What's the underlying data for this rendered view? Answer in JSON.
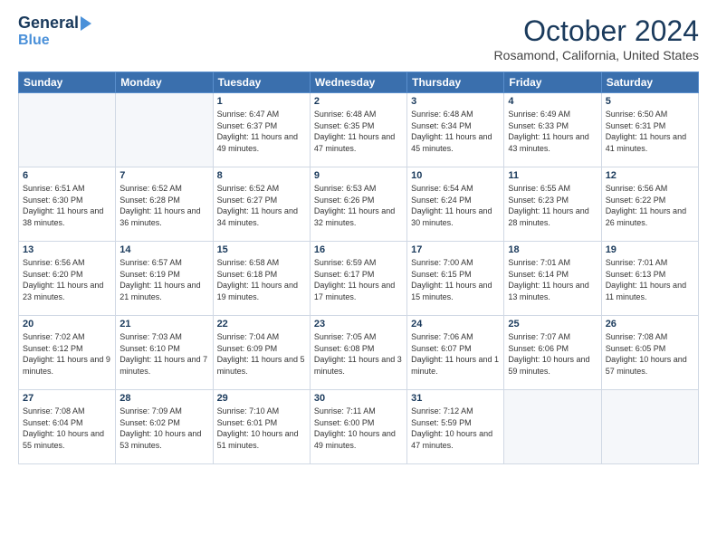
{
  "logo": {
    "line1": "General",
    "line2": "Blue"
  },
  "header": {
    "month": "October 2024",
    "location": "Rosamond, California, United States"
  },
  "weekdays": [
    "Sunday",
    "Monday",
    "Tuesday",
    "Wednesday",
    "Thursday",
    "Friday",
    "Saturday"
  ],
  "weeks": [
    [
      {
        "day": "",
        "empty": true
      },
      {
        "day": "",
        "empty": true
      },
      {
        "day": "1",
        "rise": "6:47 AM",
        "set": "6:37 PM",
        "daylight": "11 hours and 49 minutes."
      },
      {
        "day": "2",
        "rise": "6:48 AM",
        "set": "6:35 PM",
        "daylight": "11 hours and 47 minutes."
      },
      {
        "day": "3",
        "rise": "6:48 AM",
        "set": "6:34 PM",
        "daylight": "11 hours and 45 minutes."
      },
      {
        "day": "4",
        "rise": "6:49 AM",
        "set": "6:33 PM",
        "daylight": "11 hours and 43 minutes."
      },
      {
        "day": "5",
        "rise": "6:50 AM",
        "set": "6:31 PM",
        "daylight": "11 hours and 41 minutes."
      }
    ],
    [
      {
        "day": "6",
        "rise": "6:51 AM",
        "set": "6:30 PM",
        "daylight": "11 hours and 38 minutes."
      },
      {
        "day": "7",
        "rise": "6:52 AM",
        "set": "6:28 PM",
        "daylight": "11 hours and 36 minutes."
      },
      {
        "day": "8",
        "rise": "6:52 AM",
        "set": "6:27 PM",
        "daylight": "11 hours and 34 minutes."
      },
      {
        "day": "9",
        "rise": "6:53 AM",
        "set": "6:26 PM",
        "daylight": "11 hours and 32 minutes."
      },
      {
        "day": "10",
        "rise": "6:54 AM",
        "set": "6:24 PM",
        "daylight": "11 hours and 30 minutes."
      },
      {
        "day": "11",
        "rise": "6:55 AM",
        "set": "6:23 PM",
        "daylight": "11 hours and 28 minutes."
      },
      {
        "day": "12",
        "rise": "6:56 AM",
        "set": "6:22 PM",
        "daylight": "11 hours and 26 minutes."
      }
    ],
    [
      {
        "day": "13",
        "rise": "6:56 AM",
        "set": "6:20 PM",
        "daylight": "11 hours and 23 minutes."
      },
      {
        "day": "14",
        "rise": "6:57 AM",
        "set": "6:19 PM",
        "daylight": "11 hours and 21 minutes."
      },
      {
        "day": "15",
        "rise": "6:58 AM",
        "set": "6:18 PM",
        "daylight": "11 hours and 19 minutes."
      },
      {
        "day": "16",
        "rise": "6:59 AM",
        "set": "6:17 PM",
        "daylight": "11 hours and 17 minutes."
      },
      {
        "day": "17",
        "rise": "7:00 AM",
        "set": "6:15 PM",
        "daylight": "11 hours and 15 minutes."
      },
      {
        "day": "18",
        "rise": "7:01 AM",
        "set": "6:14 PM",
        "daylight": "11 hours and 13 minutes."
      },
      {
        "day": "19",
        "rise": "7:01 AM",
        "set": "6:13 PM",
        "daylight": "11 hours and 11 minutes."
      }
    ],
    [
      {
        "day": "20",
        "rise": "7:02 AM",
        "set": "6:12 PM",
        "daylight": "11 hours and 9 minutes."
      },
      {
        "day": "21",
        "rise": "7:03 AM",
        "set": "6:10 PM",
        "daylight": "11 hours and 7 minutes."
      },
      {
        "day": "22",
        "rise": "7:04 AM",
        "set": "6:09 PM",
        "daylight": "11 hours and 5 minutes."
      },
      {
        "day": "23",
        "rise": "7:05 AM",
        "set": "6:08 PM",
        "daylight": "11 hours and 3 minutes."
      },
      {
        "day": "24",
        "rise": "7:06 AM",
        "set": "6:07 PM",
        "daylight": "11 hours and 1 minute."
      },
      {
        "day": "25",
        "rise": "7:07 AM",
        "set": "6:06 PM",
        "daylight": "10 hours and 59 minutes."
      },
      {
        "day": "26",
        "rise": "7:08 AM",
        "set": "6:05 PM",
        "daylight": "10 hours and 57 minutes."
      }
    ],
    [
      {
        "day": "27",
        "rise": "7:08 AM",
        "set": "6:04 PM",
        "daylight": "10 hours and 55 minutes."
      },
      {
        "day": "28",
        "rise": "7:09 AM",
        "set": "6:02 PM",
        "daylight": "10 hours and 53 minutes."
      },
      {
        "day": "29",
        "rise": "7:10 AM",
        "set": "6:01 PM",
        "daylight": "10 hours and 51 minutes."
      },
      {
        "day": "30",
        "rise": "7:11 AM",
        "set": "6:00 PM",
        "daylight": "10 hours and 49 minutes."
      },
      {
        "day": "31",
        "rise": "7:12 AM",
        "set": "5:59 PM",
        "daylight": "10 hours and 47 minutes."
      },
      {
        "day": "",
        "empty": true
      },
      {
        "day": "",
        "empty": true
      }
    ]
  ]
}
